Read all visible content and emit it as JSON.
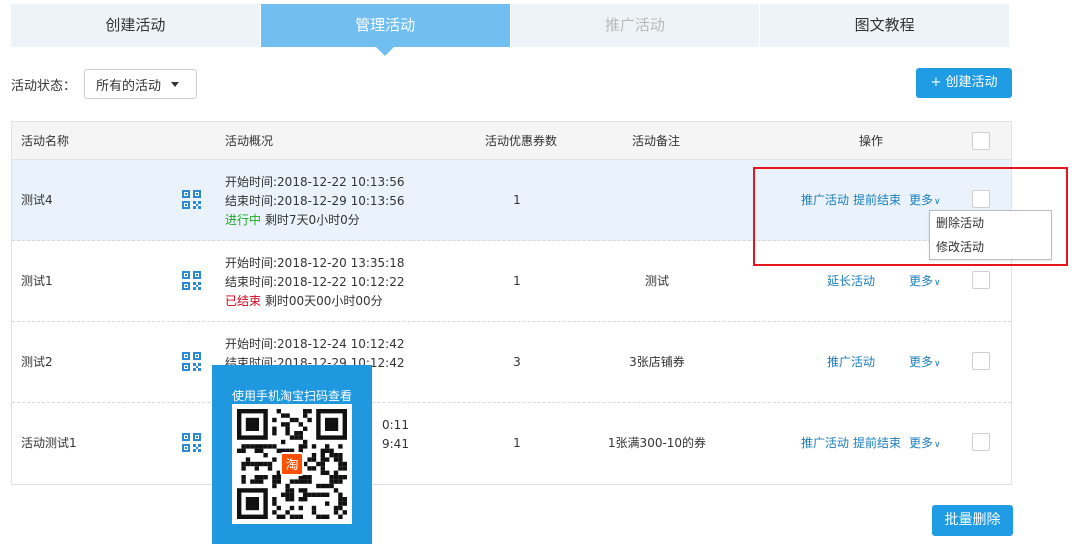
{
  "tabs": [
    {
      "label": "创建活动",
      "state": "normal"
    },
    {
      "label": "管理活动",
      "state": "active"
    },
    {
      "label": "推广活动",
      "state": "disabled"
    },
    {
      "label": "图文教程",
      "state": "normal"
    }
  ],
  "filter": {
    "label": "活动状态：",
    "selected": "所有的活动"
  },
  "create_button": "+ 创建活动",
  "table": {
    "headers": {
      "name": "活动名称",
      "summary": "活动概况",
      "count": "活动优惠券数",
      "remark": "活动备注",
      "ops": "操作"
    },
    "rows": [
      {
        "name": "测试4",
        "start": "开始时间:2018-12-22 10:13:56",
        "end": "结束时间:2018-12-29 10:13:56",
        "status": "进行中",
        "remaining": "剩时7天0小时0分",
        "count": "1",
        "remark": "",
        "links": [
          "推广活动",
          "提前结束"
        ],
        "more": "更多"
      },
      {
        "name": "测试1",
        "start": "开始时间:2018-12-20 13:35:18",
        "end": "结束时间:2018-12-22 10:12:22",
        "status": "已结束",
        "remaining": "剩时00天00小时00分",
        "count": "1",
        "remark": "测试",
        "links": [
          "延长活动"
        ],
        "more": "更多"
      },
      {
        "name": "测试2",
        "start": "开始时间:2018-12-24 10:12:42",
        "end": "结束时间:2018-12-29 10:12:42",
        "count": "3",
        "remark": "3张店铺券",
        "links": [
          "推广活动"
        ],
        "more": "更多"
      },
      {
        "name": "活动测试1",
        "start_tail": "0:11",
        "end_tail": "9:41",
        "count": "1",
        "remark": "1张满300-10的券",
        "links": [
          "推广活动",
          "提前结束"
        ],
        "more": "更多"
      }
    ]
  },
  "more_menu": [
    "删除活动",
    "修改活动"
  ],
  "qr_popup": {
    "caption": "使用手机淘宝扫码查看",
    "badge": "淘"
  },
  "batch_delete_button": "批量删除",
  "colors": {
    "tab_active": "#71bef1",
    "primary_button": "#1f9ce3",
    "link": "#1a7fc1",
    "status_running": "#22a62b",
    "status_ended": "#d0021b",
    "highlight_box": "#e3161e",
    "qr_popup_bg": "#1f98e0",
    "qr_badge": "#ff5000"
  }
}
